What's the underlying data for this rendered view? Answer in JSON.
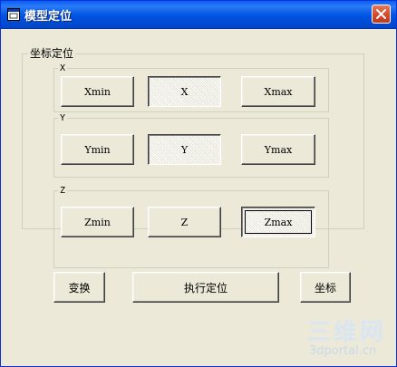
{
  "window": {
    "title": "模型定位",
    "title_color": "#ffffff",
    "titlebar_color": "#0053e1",
    "close_color": "#d34a2c"
  },
  "groups": {
    "main_label": "坐标定位",
    "x_label": "X",
    "y_label": "Y",
    "z_label": "Z"
  },
  "buttons": {
    "xmin": "Xmin",
    "x": "X",
    "xmax": "Xmax",
    "ymin": "Ymin",
    "y": "Y",
    "ymax": "Ymax",
    "zmin": "Zmin",
    "z": "Z",
    "zmax": "Zmax",
    "transform": "变换",
    "execute": "执行定位",
    "coords": "坐标"
  },
  "watermark": {
    "big": "三维网",
    "small": "3dportal.cn"
  }
}
